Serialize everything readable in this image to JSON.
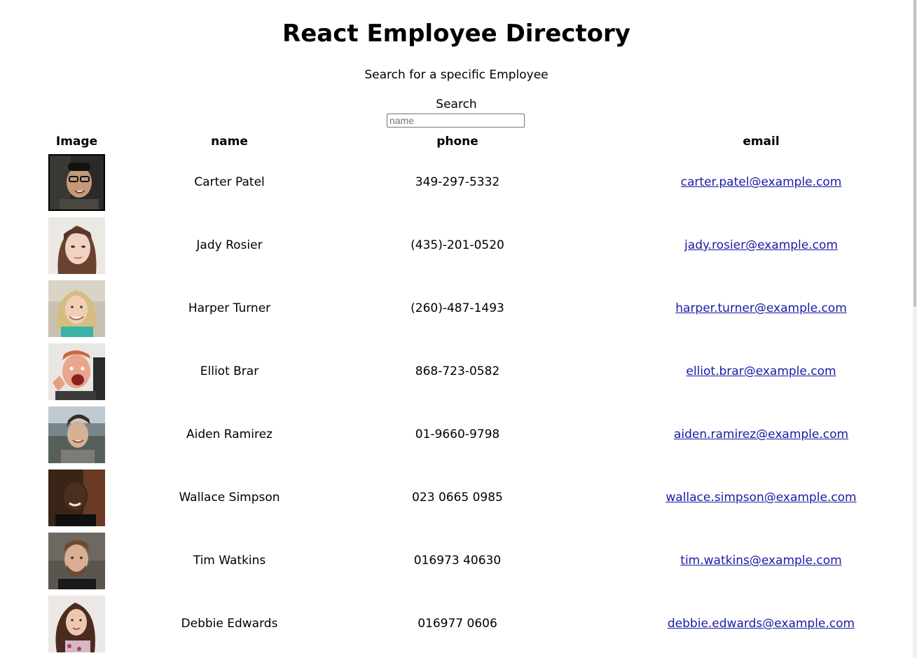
{
  "header": {
    "title": "React Employee Directory",
    "subtitle": "Search for a specific Employee"
  },
  "search": {
    "label": "Search",
    "placeholder": "name",
    "value": ""
  },
  "table": {
    "columns": [
      "Image",
      "name",
      "phone",
      "email"
    ],
    "rows": [
      {
        "name": "Carter Patel",
        "phone": "349-297-5332",
        "email": "carter.patel@example.com",
        "avatar": "man-glasses-photo"
      },
      {
        "name": "Jady Rosier",
        "phone": "(435)-201-0520",
        "email": "jady.rosier@example.com",
        "avatar": "woman-brown-hair-photo"
      },
      {
        "name": "Harper Turner",
        "phone": "(260)-487-1493",
        "email": "harper.turner@example.com",
        "avatar": "woman-blonde-photo"
      },
      {
        "name": "Elliot Brar",
        "phone": "868-723-0582",
        "email": "elliot.brar@example.com",
        "avatar": "man-red-hair-photo"
      },
      {
        "name": "Aiden Ramirez",
        "phone": "01-9660-9798",
        "email": "aiden.ramirez@example.com",
        "avatar": "man-outdoors-photo"
      },
      {
        "name": "Wallace Simpson",
        "phone": "023 0665 0985",
        "email": "wallace.simpson@example.com",
        "avatar": "man-dark-photo"
      },
      {
        "name": "Tim Watkins",
        "phone": "016973 40630",
        "email": "tim.watkins@example.com",
        "avatar": "man-beard-photo"
      },
      {
        "name": "Debbie Edwards",
        "phone": "016977 0606",
        "email": "debbie.edwards@example.com",
        "avatar": "woman-curly-hair-photo"
      }
    ]
  },
  "colors": {
    "link": "#1a1aa6",
    "text": "#000000",
    "background": "#ffffff"
  }
}
